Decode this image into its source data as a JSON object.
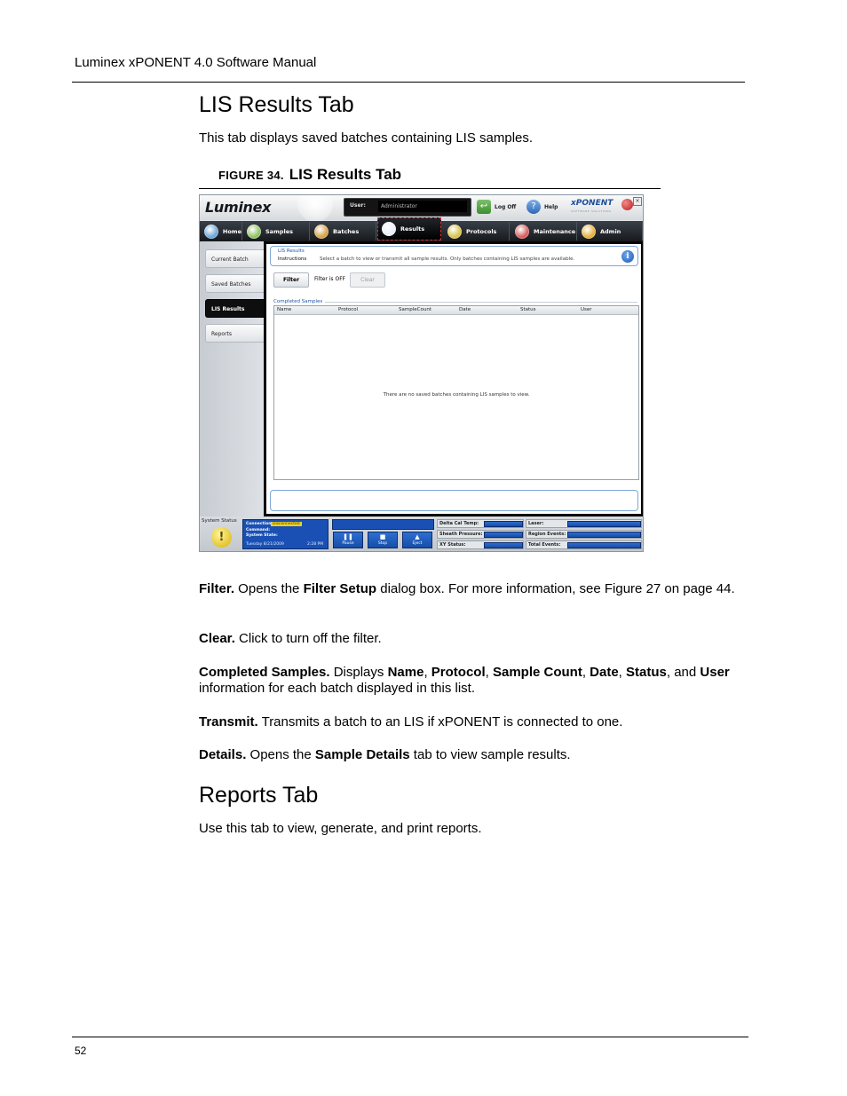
{
  "header": {
    "running_title": "Luminex xPONENT 4.0 Software Manual"
  },
  "section1": {
    "heading": "LIS Results Tab",
    "intro": "This tab displays saved batches containing LIS samples."
  },
  "figure": {
    "label": "FIGURE 34.",
    "title": "LIS Results Tab"
  },
  "screenshot": {
    "logo": "Luminex",
    "user_label": "User:",
    "user_value": "Administrator",
    "logoff_label": "Log Off",
    "help_label": "Help",
    "brand": "xPONENT",
    "brand_sub": "SOFTWARE SOLUTIONS",
    "nav_tabs": [
      {
        "label": "Home",
        "icon": "home-icon",
        "color": "#6ea7d8"
      },
      {
        "label": "Samples",
        "icon": "samples-icon",
        "color": "#8fc264"
      },
      {
        "label": "Batches",
        "icon": "batches-icon",
        "color": "#d6a24a"
      },
      {
        "label": "Results",
        "icon": "results-icon",
        "color": "#e8eef7"
      },
      {
        "label": "Protocols",
        "icon": "protocols-icon",
        "color": "#d9c34a"
      },
      {
        "label": "Maintenance",
        "icon": "maintenance-icon",
        "color": "#d85c5c"
      },
      {
        "label": "Admin",
        "icon": "admin-icon",
        "color": "#e6b03c"
      }
    ],
    "side_tabs": [
      "Current Batch",
      "Saved Batches",
      "LIS Results",
      "Reports"
    ],
    "instructions_title": "LIS Results",
    "instructions_label": "Instructions",
    "instructions_text": "Select a batch to view or transmit all sample results. Only batches containing LIS samples are available.",
    "filter_button": "Filter",
    "filter_status": "Filter is OFF",
    "clear_button": "Clear",
    "completed_label": "Completed Samples",
    "columns": [
      "Name",
      "Protocol",
      "SampleCount",
      "Date",
      "Status",
      "User"
    ],
    "empty_message": "There are no saved batches containing LIS samples to view.",
    "system_status_label": "System Status",
    "connection_label": "Connection:",
    "connection_value": "Disconnected",
    "command_label": "Command:",
    "system_state_label": "System State:",
    "date_value": "Tuesday 8/21/2009",
    "time_value": "2:28 PM",
    "control_buttons": [
      "Pause",
      "Stop",
      "Eject"
    ],
    "readouts_left": [
      "Delta Cal Temp:",
      "Sheath Pressure:",
      "XY Status:"
    ],
    "readouts_right": [
      "Laser:",
      "Region Events:",
      "Total Events:"
    ]
  },
  "descriptions": {
    "filter_term": "Filter.",
    "filter_text_1": " Opens the ",
    "filter_bold": "Filter Setup",
    "filter_text_2": " dialog box. For more information, see Figure 27 on page 44.",
    "clear_term": "Clear.",
    "clear_text": " Click to turn off the filter.",
    "completed_term": "Completed Samples.",
    "completed_text_1": " Displays ",
    "completed_name": "Name",
    "sep1": ", ",
    "completed_protocol": "Protocol",
    "sep2": ", ",
    "completed_count": "Sample Count",
    "sep3": ", ",
    "completed_date": "Date",
    "sep4": ", ",
    "completed_status": "Status",
    "sep5": ", and ",
    "completed_user": "User",
    "completed_text_2": " information for each batch displayed in this list.",
    "transmit_term": "Transmit.",
    "transmit_text": " Transmits a batch to an LIS if xPONENT is connected to one.",
    "details_term": "Details.",
    "details_text_1": " Opens the ",
    "details_bold": "Sample Details",
    "details_text_2": " tab to view sample results."
  },
  "section2": {
    "heading": "Reports Tab",
    "intro": "Use this tab to view, generate, and print reports."
  },
  "footer": {
    "page_number": "52"
  }
}
